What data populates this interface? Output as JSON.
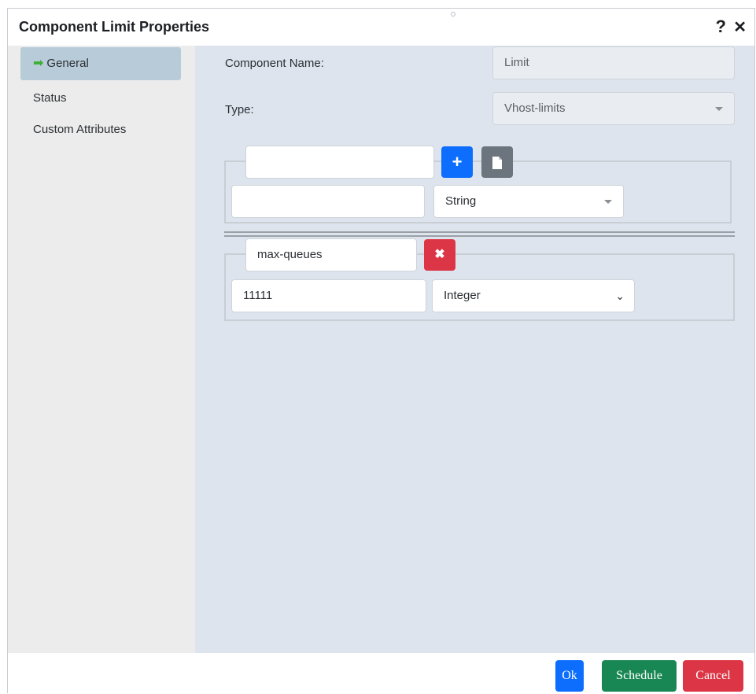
{
  "dialog": {
    "title": "Component Limit Properties",
    "help_glyph": "?",
    "close_glyph": "✕"
  },
  "sidebar": {
    "items": [
      {
        "label": "General",
        "icon": "arrow-right-icon",
        "active": true
      },
      {
        "label": "Status",
        "active": false
      },
      {
        "label": "Custom Attributes",
        "active": false
      }
    ]
  },
  "form": {
    "component_name_label": "Component Name:",
    "component_name_value": "Limit",
    "type_label": "Type:",
    "type_value": "Vhost-limits"
  },
  "new_attribute": {
    "name_value": "",
    "value_value": "",
    "type_value": "String",
    "add_glyph": "+",
    "copy_icon": "file-icon"
  },
  "attributes": [
    {
      "name": "max-queues",
      "value": "11111",
      "type": "Integer",
      "remove_glyph": "✖"
    }
  ],
  "footer": {
    "ok_label": "Ok",
    "schedule_label": "Schedule",
    "cancel_label": "Cancel"
  },
  "colors": {
    "primary": "#0d6efd",
    "success": "#198754",
    "danger": "#dc3545",
    "secondary": "#6c757d"
  }
}
